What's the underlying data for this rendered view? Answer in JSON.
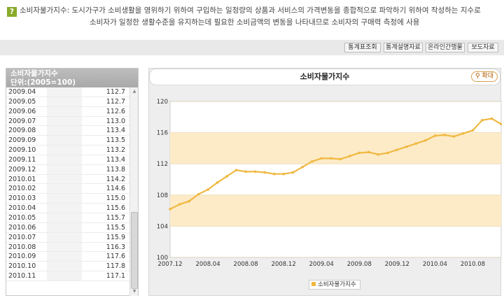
{
  "description": {
    "badge": "?",
    "line1": "소비자물가지수: 도시가구가 소비생활을 영위하기 위하여 구입하는 일정량의 상품과 서비스의 가격변동을 종합적으로 파악하기 위하여 작성하는 지수로",
    "line2": "소비자가 일정한 생활수준을 유지하는데 필요한 소비금액의 변동을 나타내므로 소비자의 구매력 측정에 사용"
  },
  "toolbar": {
    "buttons": [
      "통계표조회",
      "통계설명자료",
      "온라인간행물",
      "보도자료"
    ]
  },
  "table": {
    "title": "소비자물가지수",
    "unit": "단위:(2005=100)",
    "rows": [
      {
        "date": "2009.04",
        "value": "112.7"
      },
      {
        "date": "2009.05",
        "value": "112.7"
      },
      {
        "date": "2009.06",
        "value": "112.6"
      },
      {
        "date": "2009.07",
        "value": "113.0"
      },
      {
        "date": "2009.08",
        "value": "113.4"
      },
      {
        "date": "2009.09",
        "value": "113.5"
      },
      {
        "date": "2009.10",
        "value": "113.2"
      },
      {
        "date": "2009.11",
        "value": "113.4"
      },
      {
        "date": "2009.12",
        "value": "113.8"
      },
      {
        "date": "2010.01",
        "value": "114.2"
      },
      {
        "date": "2010.02",
        "value": "114.6"
      },
      {
        "date": "2010.03",
        "value": "115.0"
      },
      {
        "date": "2010.04",
        "value": "115.6"
      },
      {
        "date": "2010.05",
        "value": "115.7"
      },
      {
        "date": "2010.06",
        "value": "115.5"
      },
      {
        "date": "2010.07",
        "value": "115.9"
      },
      {
        "date": "2010.08",
        "value": "116.3"
      },
      {
        "date": "2010.09",
        "value": "117.6"
      },
      {
        "date": "2010.10",
        "value": "117.8"
      },
      {
        "date": "2010.11",
        "value": "117.1"
      }
    ]
  },
  "chart_header": {
    "title": "소비자물가지수",
    "zoom_label": "확대"
  },
  "chart_data": {
    "type": "line",
    "x_start": "2007.12",
    "x": [
      "2007.12",
      "2008.01",
      "2008.02",
      "2008.03",
      "2008.04",
      "2008.05",
      "2008.06",
      "2008.07",
      "2008.08",
      "2008.09",
      "2008.10",
      "2008.11",
      "2008.12",
      "2009.01",
      "2009.02",
      "2009.03",
      "2009.04",
      "2009.05",
      "2009.06",
      "2009.07",
      "2009.08",
      "2009.09",
      "2009.10",
      "2009.11",
      "2009.12",
      "2010.01",
      "2010.02",
      "2010.03",
      "2010.04",
      "2010.05",
      "2010.06",
      "2010.07",
      "2010.08",
      "2010.09",
      "2010.10",
      "2010.11"
    ],
    "series": [
      {
        "name": "소비자물가지수",
        "color": "#f0b840",
        "values": [
          106.2,
          106.8,
          107.2,
          108.1,
          108.7,
          109.6,
          110.4,
          111.2,
          111.0,
          111.0,
          110.9,
          110.7,
          110.7,
          110.9,
          111.6,
          112.3,
          112.7,
          112.7,
          112.6,
          113.0,
          113.4,
          113.5,
          113.2,
          113.4,
          113.8,
          114.2,
          114.6,
          115.0,
          115.6,
          115.7,
          115.5,
          115.9,
          116.3,
          117.6,
          117.8,
          117.1
        ]
      }
    ],
    "x_tick_labels": [
      "2007.12",
      "2008.04",
      "2008.08",
      "2008.12",
      "2009.04",
      "2009.08",
      "2009.12",
      "2010.04",
      "2010.08"
    ],
    "y_ticks": [
      100,
      104,
      108,
      112,
      116,
      120
    ],
    "ylim": [
      100,
      120
    ],
    "bands": [
      [
        104,
        108
      ],
      [
        112,
        116
      ]
    ],
    "band_color": "#fdebc8",
    "legend": "소비자물가지수",
    "legend_position": "bottom"
  }
}
